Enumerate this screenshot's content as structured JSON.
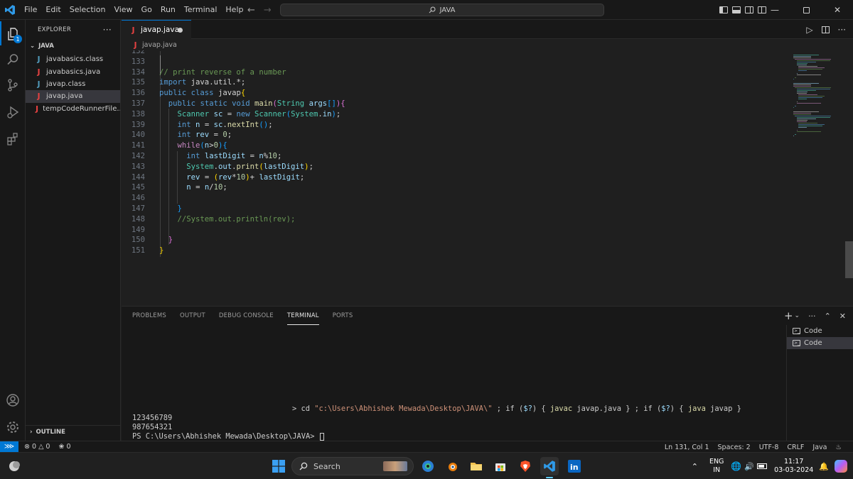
{
  "titlebar": {
    "menus": [
      "File",
      "Edit",
      "Selection",
      "View",
      "Go",
      "Run",
      "Terminal",
      "Help"
    ],
    "command_center": "JAVA"
  },
  "activity_bar": {
    "explorer_badge": "1"
  },
  "sidebar": {
    "title": "EXPLORER",
    "more": "···",
    "folder": "JAVA",
    "files": [
      {
        "name": "javabasics.class",
        "icon": "J",
        "icon_color": "#519aba"
      },
      {
        "name": "javabasics.java",
        "icon": "J",
        "icon_color": "#e44141"
      },
      {
        "name": "javap.class",
        "icon": "J",
        "icon_color": "#519aba"
      },
      {
        "name": "javap.java",
        "icon": "J",
        "icon_color": "#e44141"
      },
      {
        "name": "tempCodeRunnerFile....",
        "icon": "J",
        "icon_color": "#e44141"
      }
    ],
    "outline": "OUTLINE"
  },
  "editor": {
    "tab": {
      "icon": "J",
      "label": "javap.java"
    },
    "breadcrumb": "javap.java",
    "lines": [
      {
        "n": "132",
        "code": ""
      },
      {
        "n": "133",
        "code": ""
      },
      {
        "n": "134",
        "code": "// print reverse of a number"
      },
      {
        "n": "135",
        "code": "import java.util.*;"
      },
      {
        "n": "136",
        "code": "public class javap{"
      },
      {
        "n": "137",
        "code": "  public static void main(String args[]){"
      },
      {
        "n": "138",
        "code": "    Scanner sc = new Scanner(System.in);"
      },
      {
        "n": "139",
        "code": "    int n = sc.nextInt();"
      },
      {
        "n": "140",
        "code": "    int rev = 0;"
      },
      {
        "n": "141",
        "code": "    while(n>0){"
      },
      {
        "n": "142",
        "code": "      int lastDigit = n%10;"
      },
      {
        "n": "143",
        "code": "      System.out.print(lastDigit);"
      },
      {
        "n": "144",
        "code": "      rev = (rev*10)+ lastDigit;"
      },
      {
        "n": "145",
        "code": "      n = n/10;"
      },
      {
        "n": "146",
        "code": ""
      },
      {
        "n": "147",
        "code": "    }"
      },
      {
        "n": "148",
        "code": "    //System.out.println(rev);"
      },
      {
        "n": "149",
        "code": ""
      },
      {
        "n": "150",
        "code": "  }"
      },
      {
        "n": "151",
        "code": "}"
      }
    ]
  },
  "panel": {
    "tabs": [
      "PROBLEMS",
      "OUTPUT",
      "DEBUG CONSOLE",
      "TERMINAL",
      "PORTS"
    ],
    "active_tab": "TERMINAL",
    "terminals": [
      "Code",
      "Code"
    ],
    "terminal_lines": {
      "command": "> cd \"c:\\Users\\Abhishek Mewada\\Desktop\\JAVA\\\" ; if ($?) { javac javap.java } ; if ($?) { java javap }",
      "input": "123456789",
      "output": "987654321",
      "prompt": "PS C:\\Users\\Abhishek Mewada\\Desktop\\JAVA> "
    }
  },
  "statusbar": {
    "errors": "0",
    "warnings": "0",
    "ports": "0",
    "position": "Ln 131, Col 1",
    "spaces": "Spaces: 2",
    "encoding": "UTF-8",
    "eol": "CRLF",
    "language": "Java"
  },
  "taskbar": {
    "search_placeholder": "Search",
    "lang_top": "ENG",
    "lang_bottom": "IN",
    "time": "11:17",
    "date": "03-03-2024"
  }
}
